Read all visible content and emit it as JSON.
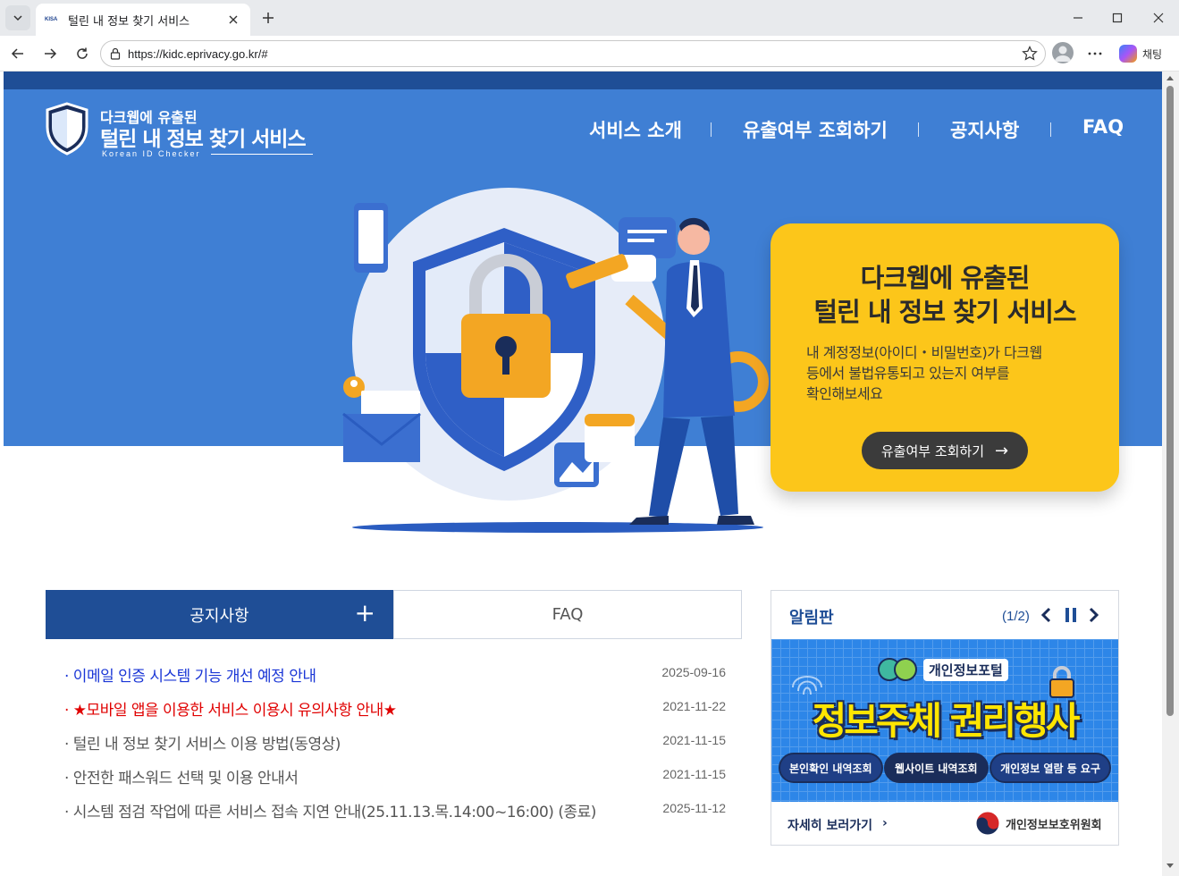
{
  "browser": {
    "tab_favicon": "KISA",
    "tab_title": "털린 내 정보 찾기 서비스",
    "url": "https://kidc.eprivacy.go.kr/#",
    "copilot_label": "채팅"
  },
  "header": {
    "logo_top": "다크웹에 유출된",
    "logo_main": "털린 내 정보 찾기 서비스",
    "logo_sub": "Korean ID Checker",
    "nav": [
      "서비스 소개",
      "유출여부 조회하기",
      "공지사항",
      "FAQ"
    ]
  },
  "hero": {
    "title_line1": "다크웹에 유출된",
    "title_line2": "털린 내 정보 찾기 서비스",
    "desc_line1": "내 계정정보(아이디・비밀번호)가 다크웹",
    "desc_line2": "등에서 불법유통되고 있는지 여부를",
    "desc_line3": "확인해보세요",
    "button": "유출여부 조회하기",
    "button_arrow": "→"
  },
  "board": {
    "tab_notice": "공지사항",
    "tab_plus": "+",
    "tab_faq": "FAQ",
    "items": [
      {
        "text": "· 이메일 인증 시스템 기능 개선 예정 안내",
        "date": "2025-09-16",
        "color": "#1a36d6"
      },
      {
        "text": "· ★모바일 앱을 이용한 서비스 이용시 유의사항 안내★",
        "date": "2021-11-22",
        "color": "#e00000"
      },
      {
        "text": "· 털린 내 정보 찾기 서비스 이용 방법(동영상)",
        "date": "2021-11-15",
        "color": "#555555"
      },
      {
        "text": "· 안전한 패스워드 선택 및 이용 안내서",
        "date": "2021-11-15",
        "color": "#555555"
      },
      {
        "text": "· 시스템 점검 작업에 따른 서비스 접속 지연 안내(25.11.13.목.14:00~16:00) (종료)",
        "date": "2025-11-12",
        "color": "#555555"
      }
    ]
  },
  "alarm": {
    "title": "알림판",
    "count": "(1/2)",
    "banner_portal": "개인정보포털",
    "banner_headline": "정보주체 권리행사",
    "banner_pills": [
      "본인확인 내역조회",
      "웹사이트 내역조회",
      "개인정보 열람 등 요구"
    ],
    "more": "자세히 보러가기",
    "more_arrow": "›",
    "org": "개인정보보호위원회"
  },
  "colors": {
    "brand": "#1f4e96",
    "hero_bg": "#3f7fd4",
    "card": "#fcc61a"
  }
}
